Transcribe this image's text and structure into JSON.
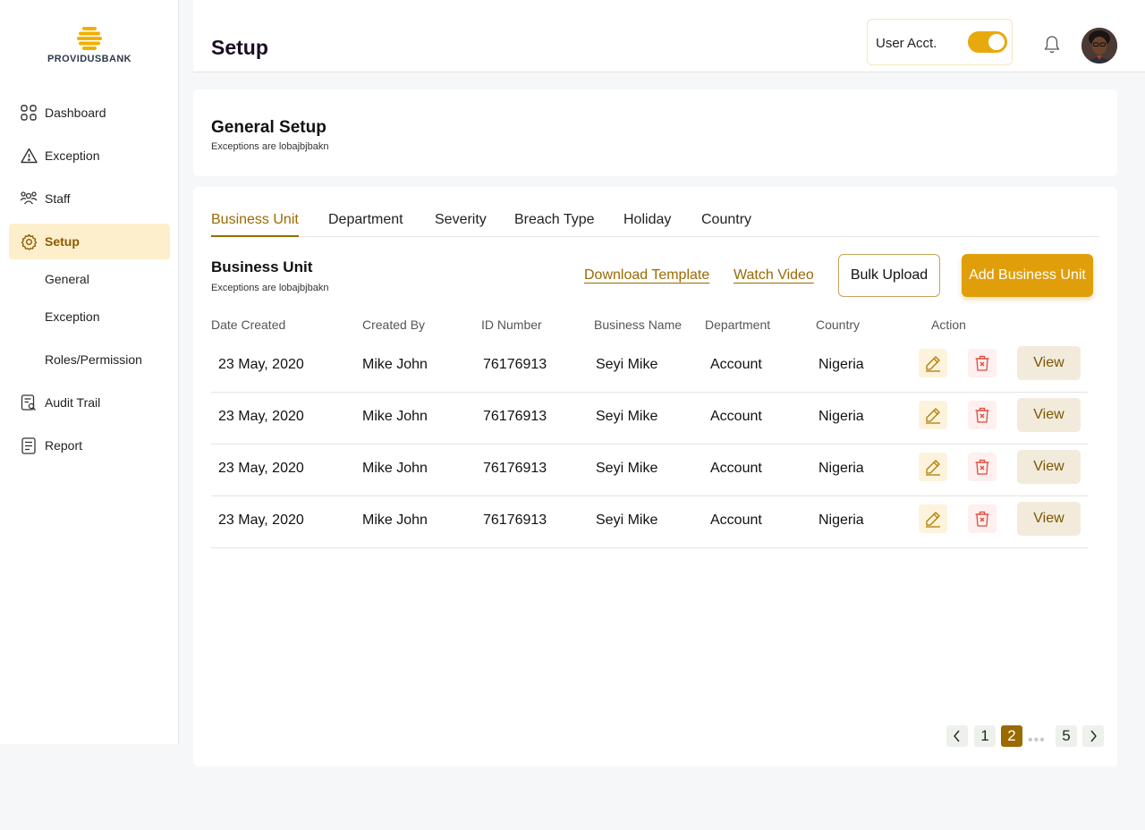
{
  "brand": {
    "name": "PROVIDUSBANK",
    "color": "#e8a90c"
  },
  "sidebar": {
    "items": [
      {
        "label": "Dashboard",
        "icon": "grid-icon"
      },
      {
        "label": "Exception",
        "icon": "warning-icon"
      },
      {
        "label": "Staff",
        "icon": "users-icon"
      },
      {
        "label": "Setup",
        "icon": "gear-icon",
        "active": true
      },
      {
        "label": "Audit Trail",
        "icon": "audit-icon"
      },
      {
        "label": "Report",
        "icon": "report-icon"
      }
    ],
    "sub_items": [
      {
        "label": "General"
      },
      {
        "label": "Exception"
      },
      {
        "label": "Roles/Permission"
      }
    ]
  },
  "header": {
    "title": "Setup",
    "user_acct_label": "User Acct.",
    "toggle_on": true
  },
  "general_setup": {
    "title": "General Setup",
    "subtitle": "Exceptions are lobajbjbakn"
  },
  "tabs": [
    {
      "label": "Business Unit",
      "active": true
    },
    {
      "label": "Department"
    },
    {
      "label": "Severity"
    },
    {
      "label": "Breach Type"
    },
    {
      "label": "Holiday"
    },
    {
      "label": "Country"
    }
  ],
  "section": {
    "title": "Business Unit",
    "subtitle": "Exceptions are lobajbjbakn",
    "download_template": "Download Template",
    "watch_video": "Watch Video",
    "bulk_upload": "Bulk Upload",
    "add_button": "Add Business Unit"
  },
  "table": {
    "headers": [
      "Date Created",
      "Created By",
      "ID Number",
      "Business Name",
      "Department",
      "Country",
      "Action"
    ],
    "rows": [
      {
        "date": "23 May, 2020",
        "created_by": "Mike John",
        "id": "76176913",
        "business": "Seyi Mike",
        "department": "Account",
        "country": "Nigeria",
        "view": "View"
      },
      {
        "date": "23 May, 2020",
        "created_by": "Mike John",
        "id": "76176913",
        "business": "Seyi Mike",
        "department": "Account",
        "country": "Nigeria",
        "view": "View"
      },
      {
        "date": "23 May, 2020",
        "created_by": "Mike John",
        "id": "76176913",
        "business": "Seyi Mike",
        "department": "Account",
        "country": "Nigeria",
        "view": "View"
      },
      {
        "date": "23 May, 2020",
        "created_by": "Mike John",
        "id": "76176913",
        "business": "Seyi Mike",
        "department": "Account",
        "country": "Nigeria",
        "view": "View"
      }
    ]
  },
  "pagination": {
    "pages": [
      "1",
      "2",
      "5"
    ],
    "current": "2",
    "ellipsis": "•••"
  }
}
